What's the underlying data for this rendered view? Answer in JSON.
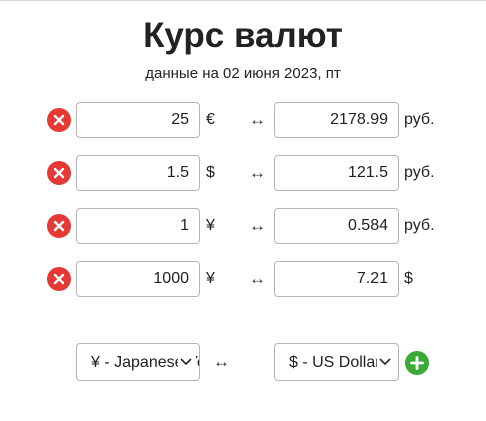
{
  "header": {
    "title": "Курс валют",
    "subtitle": "данные на 02 июня 2023, пт"
  },
  "conversions": [
    {
      "amount": "25",
      "from_symbol": "€",
      "arrow": "↔",
      "result": "2178.99",
      "to_symbol": "руб."
    },
    {
      "amount": "1.5",
      "from_symbol": "$",
      "arrow": "↔",
      "result": "121.5",
      "to_symbol": "руб."
    },
    {
      "amount": "1",
      "from_symbol": "¥",
      "arrow": "↔",
      "result": "0.584",
      "to_symbol": "руб."
    },
    {
      "amount": "1000",
      "from_symbol": "¥",
      "arrow": "↔",
      "result": "7.21",
      "to_symbol": "$"
    }
  ],
  "add_pair": {
    "from_currency": "¥ - Japanese Yen",
    "arrow": "↔",
    "to_currency": "$ - US Dollar"
  },
  "colors": {
    "remove": "#e53935",
    "add": "#3aaa35"
  },
  "icons": {
    "remove": "close-icon",
    "add": "plus-icon",
    "dropdown": "chevron-down-icon",
    "swap": "left-right-arrow-icon"
  }
}
